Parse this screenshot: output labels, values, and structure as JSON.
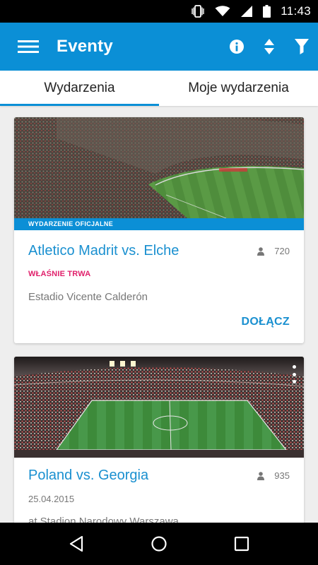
{
  "status_bar": {
    "time": "11:43",
    "icons": [
      "vibrate-icon",
      "wifi-icon",
      "signal-icon",
      "battery-icon"
    ]
  },
  "app_bar": {
    "title": "Eventy",
    "color": "#0b8fd6",
    "actions": [
      "menu-icon",
      "info-icon",
      "sort-icon",
      "filter-icon"
    ]
  },
  "tabs": [
    {
      "label": "Wydarzenia",
      "active": true
    },
    {
      "label": "Moje wydarzenia",
      "active": false
    }
  ],
  "events": [
    {
      "badge": "WYDARZENIE OFICJALNE",
      "title": "Atletico Madrit vs. Elche",
      "attendees": "720",
      "status": "WŁAŚNIE TRWA",
      "venue": "Estadio Vicente Calderón",
      "action": "DOŁĄCZ"
    },
    {
      "title": "Poland vs. Georgia",
      "attendees": "935",
      "date": "25.04.2015",
      "venue": "at Stadion Narodowy Warszawa"
    }
  ],
  "nav_bar": [
    "back-icon",
    "home-icon",
    "recents-icon"
  ]
}
